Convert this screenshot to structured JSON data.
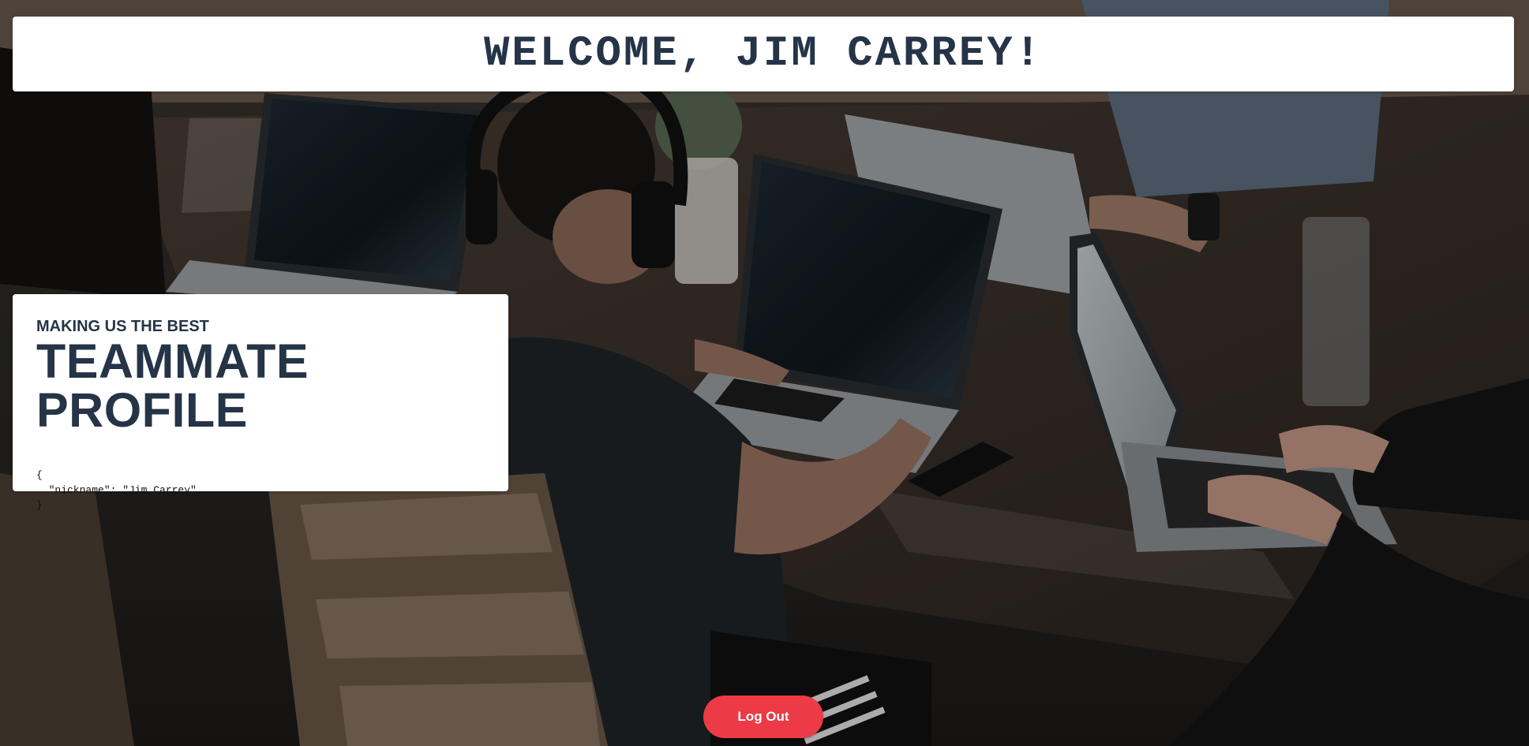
{
  "header": {
    "welcome_text": "WELCOME, JIM CARREY!"
  },
  "profile": {
    "subtitle": "MAKING US THE BEST",
    "title": "TEAMMATE PROFILE",
    "json_text": "{\n  \"nickname\": \"Jim Carrey\"\n}"
  },
  "actions": {
    "logout_label": "Log Out"
  },
  "colors": {
    "heading": "#253447",
    "logout_button": "#ec3b47",
    "card_background": "#ffffff"
  },
  "background": {
    "image_subject": "people working on laptops around a wooden table"
  }
}
